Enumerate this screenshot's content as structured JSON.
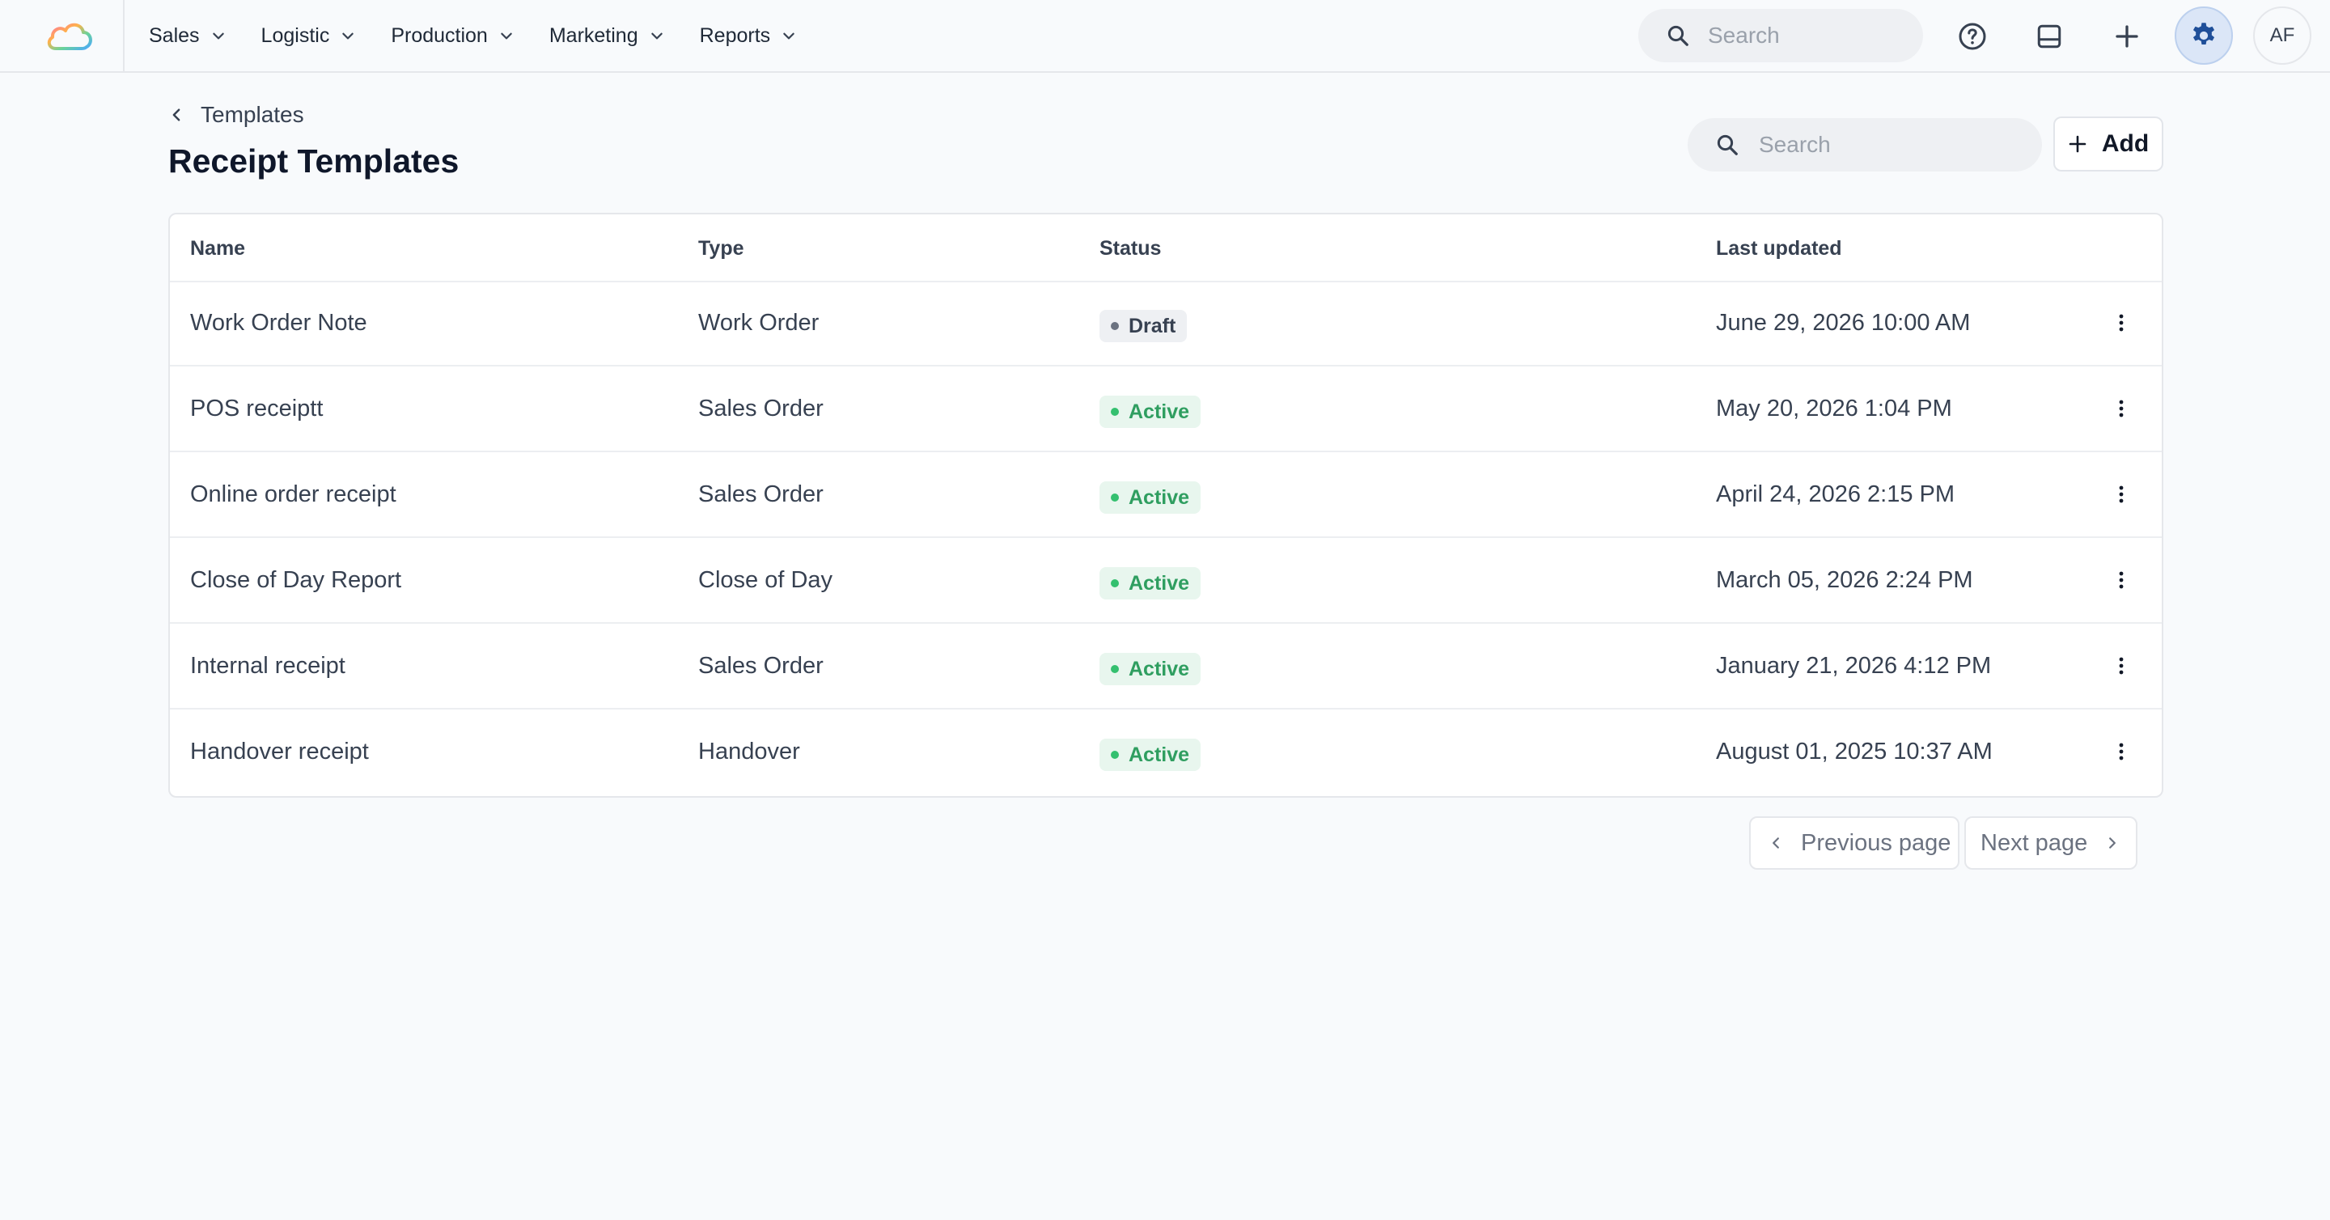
{
  "nav": {
    "items": [
      {
        "label": "Sales"
      },
      {
        "label": "Logistic"
      },
      {
        "label": "Production"
      },
      {
        "label": "Marketing"
      },
      {
        "label": "Reports"
      }
    ]
  },
  "topbar": {
    "search_placeholder": "Search",
    "avatar_initials": "AF",
    "icons": [
      "help-icon",
      "inbox-icon",
      "plus-icon",
      "gear-icon"
    ]
  },
  "header": {
    "breadcrumb": "Templates",
    "title": "Receipt Templates",
    "search_placeholder": "Search",
    "add_label": "Add"
  },
  "table": {
    "columns": {
      "name": "Name",
      "type": "Type",
      "status": "Status",
      "updated": "Last updated"
    },
    "rows": [
      {
        "name": "Work Order Note",
        "type": "Work Order",
        "status": "Draft",
        "updated": "June 29, 2026 10:00 AM"
      },
      {
        "name": "POS receiptt",
        "type": "Sales Order",
        "status": "Active",
        "updated": "May 20, 2026 1:04 PM"
      },
      {
        "name": "Online order receipt",
        "type": "Sales Order",
        "status": "Active",
        "updated": "April 24, 2026 2:15 PM"
      },
      {
        "name": "Close of Day Report",
        "type": "Close of Day",
        "status": "Active",
        "updated": "March 05, 2026 2:24 PM"
      },
      {
        "name": "Internal receipt",
        "type": "Sales Order",
        "status": "Active",
        "updated": "January 21, 2026 4:12 PM"
      },
      {
        "name": "Handover receipt",
        "type": "Handover",
        "status": "Active",
        "updated": "August 01, 2025 10:37 AM"
      }
    ]
  },
  "pagination": {
    "prev_label": "Previous page",
    "next_label": "Next page"
  },
  "colors": {
    "background": "#f8fafc",
    "accent": "#1f4f99",
    "active_green": "#2f9e60",
    "draft_gray": "#6b7280"
  }
}
